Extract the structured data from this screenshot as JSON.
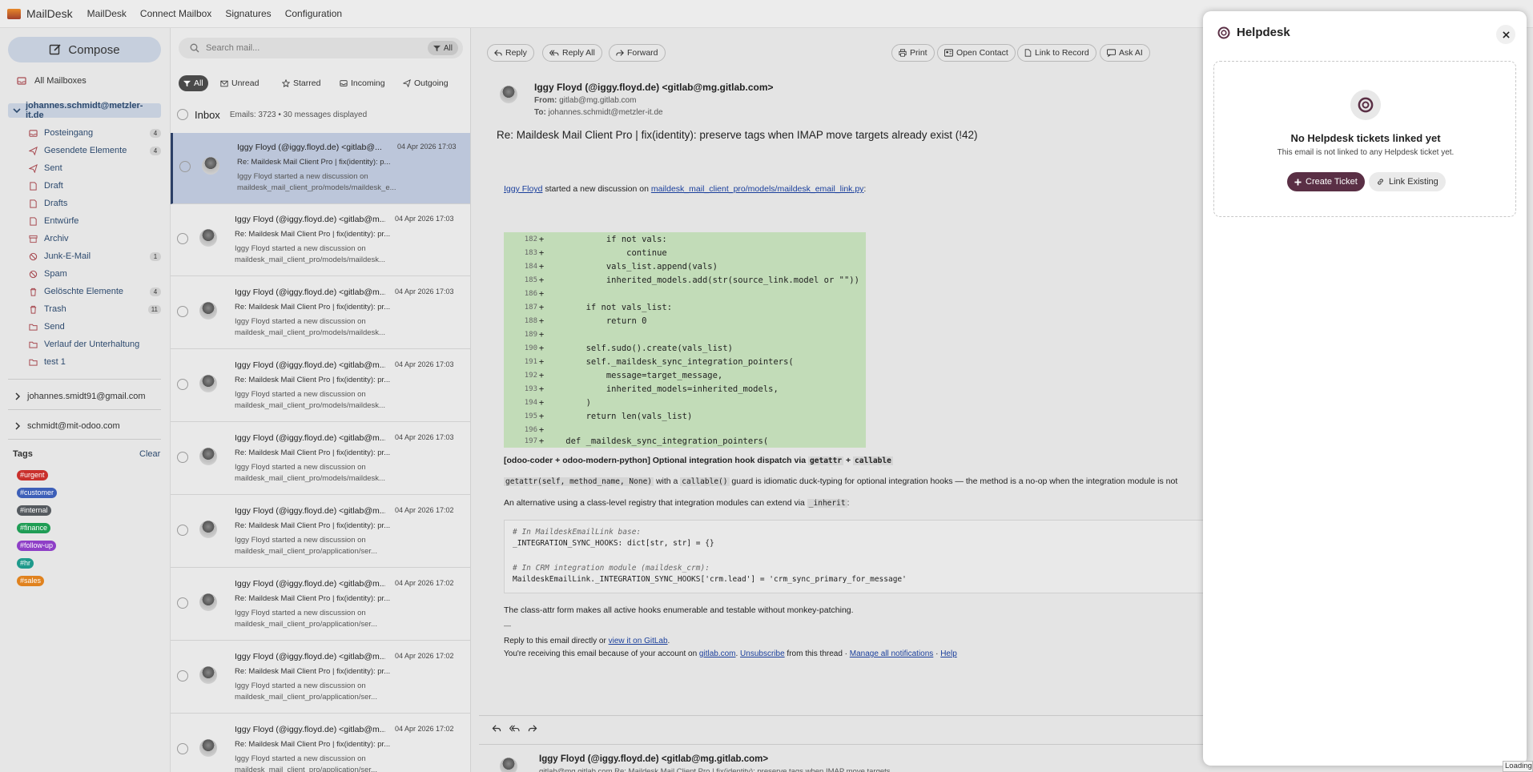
{
  "app": {
    "name": "MailDesk"
  },
  "nav": [
    "MailDesk",
    "Connect Mailbox",
    "Signatures",
    "Configuration"
  ],
  "sidebar": {
    "compose": "Compose",
    "all_mailboxes": "All Mailboxes",
    "account_expanded": "johannes.schmidt@metzler-it.de",
    "folders": [
      {
        "label": "Posteingang",
        "count": "4"
      },
      {
        "label": "Gesendete Elemente",
        "count": "4"
      },
      {
        "label": "Sent",
        "count": ""
      },
      {
        "label": "Draft",
        "count": ""
      },
      {
        "label": "Drafts",
        "count": ""
      },
      {
        "label": "Entwürfe",
        "count": ""
      },
      {
        "label": "Archiv",
        "count": ""
      },
      {
        "label": "Junk-E-Mail",
        "count": "1"
      },
      {
        "label": "Spam",
        "count": ""
      },
      {
        "label": "Gelöschte Elemente",
        "count": "4"
      },
      {
        "label": "Trash",
        "count": "11"
      },
      {
        "label": "Send",
        "count": ""
      },
      {
        "label": "Verlauf der Unterhaltung",
        "count": ""
      },
      {
        "label": "test 1",
        "count": ""
      }
    ],
    "accounts": [
      "johannes.smidt91@gmail.com",
      "schmidt@mit-odoo.com"
    ],
    "tags_label": "Tags",
    "tags_clear": "Clear",
    "tags": [
      {
        "label": "#urgent",
        "color": "#c9302c"
      },
      {
        "label": "#customer",
        "color": "#3d5fb8"
      },
      {
        "label": "#internal",
        "color": "#555a5f"
      },
      {
        "label": "#finance",
        "color": "#1f9d55"
      },
      {
        "label": "#follow-up",
        "color": "#8e3fc7"
      },
      {
        "label": "#hr",
        "color": "#1e9a8c"
      },
      {
        "label": "#sales",
        "color": "#e0821e"
      }
    ]
  },
  "list": {
    "search_placeholder": "Search mail...",
    "search_scope": "All",
    "filters": [
      "All",
      "Unread",
      "Starred",
      "Incoming",
      "Outgoing"
    ],
    "folder": "Inbox",
    "stats": "Emails: 3723 • 30 messages displayed",
    "emails": [
      {
        "from": "Iggy Floyd (@iggy.floyd.de) <gitlab@...",
        "date": "04 Apr 2026 17:03",
        "subject": "Re: Maildesk Mail Client Pro | fix(identity): p...",
        "preview": "Iggy Floyd started a new discussion on maildesk_mail_client_pro/models/maildesk_e..."
      },
      {
        "from": "Iggy Floyd (@iggy.floyd.de) <gitlab@m...",
        "date": "04 Apr 2026 17:03",
        "subject": "Re: Maildesk Mail Client Pro | fix(identity): pr...",
        "preview": "Iggy Floyd started a new discussion on maildesk_mail_client_pro/models/maildesk..."
      },
      {
        "from": "Iggy Floyd (@iggy.floyd.de) <gitlab@m...",
        "date": "04 Apr 2026 17:03",
        "subject": "Re: Maildesk Mail Client Pro | fix(identity): pr...",
        "preview": "Iggy Floyd started a new discussion on maildesk_mail_client_pro/models/maildesk..."
      },
      {
        "from": "Iggy Floyd (@iggy.floyd.de) <gitlab@m...",
        "date": "04 Apr 2026 17:03",
        "subject": "Re: Maildesk Mail Client Pro | fix(identity): pr...",
        "preview": "Iggy Floyd started a new discussion on maildesk_mail_client_pro/models/maildesk..."
      },
      {
        "from": "Iggy Floyd (@iggy.floyd.de) <gitlab@m...",
        "date": "04 Apr 2026 17:03",
        "subject": "Re: Maildesk Mail Client Pro | fix(identity): pr...",
        "preview": "Iggy Floyd started a new discussion on maildesk_mail_client_pro/models/maildesk..."
      },
      {
        "from": "Iggy Floyd (@iggy.floyd.de) <gitlab@m...",
        "date": "04 Apr 2026 17:02",
        "subject": "Re: Maildesk Mail Client Pro | fix(identity): pr...",
        "preview": "Iggy Floyd started a new discussion on maildesk_mail_client_pro/application/ser..."
      },
      {
        "from": "Iggy Floyd (@iggy.floyd.de) <gitlab@m...",
        "date": "04 Apr 2026 17:02",
        "subject": "Re: Maildesk Mail Client Pro | fix(identity): pr...",
        "preview": "Iggy Floyd started a new discussion on maildesk_mail_client_pro/application/ser..."
      },
      {
        "from": "Iggy Floyd (@iggy.floyd.de) <gitlab@m...",
        "date": "04 Apr 2026 17:02",
        "subject": "Re: Maildesk Mail Client Pro | fix(identity): pr...",
        "preview": "Iggy Floyd started a new discussion on maildesk_mail_client_pro/application/ser..."
      },
      {
        "from": "Iggy Floyd (@iggy.floyd.de) <gitlab@m...",
        "date": "04 Apr 2026 17:02",
        "subject": "Re: Maildesk Mail Client Pro | fix(identity): pr...",
        "preview": "Iggy Floyd started a new discussion on maildesk_mail_client_pro/application/ser..."
      }
    ]
  },
  "reader": {
    "actions_left": [
      "Reply",
      "Reply All",
      "Forward"
    ],
    "actions_right": [
      "Print",
      "Open Contact",
      "Link to Record",
      "Ask AI"
    ],
    "sender": "Iggy Floyd (@iggy.floyd.de) <gitlab@mg.gitlab.com>",
    "from_label": "From:",
    "from_value": "gitlab@mg.gitlab.com",
    "to_label": "To:",
    "to_value": "johannes.schmidt@metzler-it.de",
    "subject": "Re: Maildesk Mail Client Pro | fix(identity): preserve tags when IMAP move targets already exist (!42)",
    "intro_author": "Iggy Floyd",
    "intro_middle": " started a new discussion on ",
    "intro_file": "maildesk_mail_client_pro/models/maildesk_email_link.py",
    "intro_end": ":",
    "code_lines": [
      {
        "n": "182",
        "t": "            if not vals:"
      },
      {
        "n": "183",
        "t": "                continue"
      },
      {
        "n": "184",
        "t": "            vals_list.append(vals)"
      },
      {
        "n": "185",
        "t": "            inherited_models.add(str(source_link.model or \"\"))"
      },
      {
        "n": "186",
        "t": ""
      },
      {
        "n": "187",
        "t": "        if not vals_list:"
      },
      {
        "n": "188",
        "t": "            return 0"
      },
      {
        "n": "189",
        "t": ""
      },
      {
        "n": "190",
        "t": "        self.sudo().create(vals_list)"
      },
      {
        "n": "191",
        "t": "        self._maildesk_sync_integration_pointers("
      },
      {
        "n": "192",
        "t": "            message=target_message,"
      },
      {
        "n": "193",
        "t": "            inherited_models=inherited_models,"
      },
      {
        "n": "194",
        "t": "        )"
      },
      {
        "n": "195",
        "t": "        return len(vals_list)"
      },
      {
        "n": "196",
        "t": ""
      },
      {
        "n": "197",
        "t": "    def _maildesk_sync_integration_pointers("
      }
    ],
    "para1_a": "[odoo-coder + odoo-modern-python] Optional integration hook dispatch via ",
    "para1_c1": "getattr",
    "para1_b": " + ",
    "para1_c2": "callable",
    "para2_c1": "getattr(self, method_name, None)",
    "para2_a": " with a ",
    "para2_c2": "callable()",
    "para2_b": " guard is idiomatic duck-typing for optional integration hooks — the method is a no-op when the integration module is not",
    "para3_a": "An alternative using a class-level registry that integration modules can extend via ",
    "para3_c": "_inherit",
    "para3_b": ":",
    "pre_lines": [
      "# In MaildeskEmailLink base:",
      "_INTEGRATION_SYNC_HOOKS: dict[str, str] = {}",
      "",
      "# In CRM integration module (maildesk_crm):",
      "MaildeskEmailLink._INTEGRATION_SYNC_HOOKS['crm.lead'] = 'crm_sync_primary_for_message'"
    ],
    "para4": "The class-attr form makes all active hooks enumerable and testable without monkey-patching.",
    "sig": "—",
    "footer1_a": "Reply to this email directly or ",
    "footer1_link": "view it on GitLab",
    "footer1_b": ".",
    "footer2_a": "You're receiving this email because of your account on ",
    "footer2_link1": "gitlab.com",
    "footer2_b": ". ",
    "footer2_link2": "Unsubscribe",
    "footer2_c": " from this thread · ",
    "footer2_link3": "Manage all notifications",
    "footer2_d": " · ",
    "footer2_link4": "Help",
    "thread2_sender": "Iggy Floyd (@iggy.floyd.de) <gitlab@mg.gitlab.com>",
    "thread2_sub": "gitlab@mg.gitlab.com  Re: Maildesk Mail Client Pro | fix(identity): preserve tags when IMAP move targets"
  },
  "helpdesk": {
    "title": "Helpdesk",
    "empty_title": "No Helpdesk tickets linked yet",
    "empty_text": "This email is not linked to any Helpdesk ticket yet.",
    "create": "Create Ticket",
    "link": "Link Existing",
    "accent": "#5a2f45"
  },
  "status": "Loading"
}
